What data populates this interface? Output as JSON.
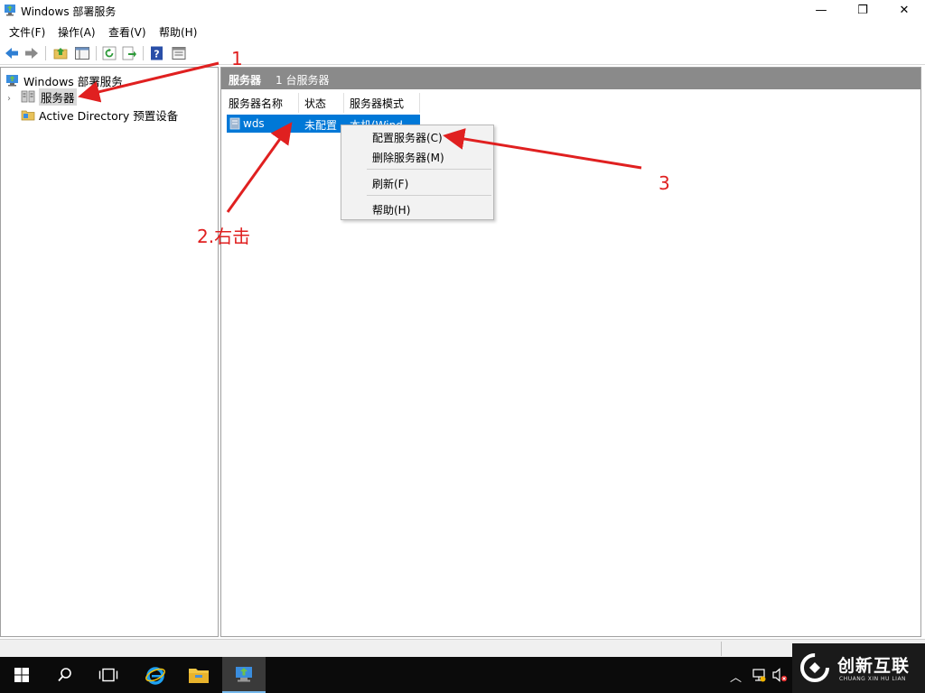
{
  "window": {
    "title": "Windows 部署服务",
    "controls": {
      "minimize": "—",
      "maximize": "❐",
      "close": "✕"
    }
  },
  "menubar": {
    "items": [
      {
        "label": "文件(F)"
      },
      {
        "label": "操作(A)"
      },
      {
        "label": "查看(V)"
      },
      {
        "label": "帮助(H)"
      }
    ]
  },
  "toolbar": {
    "buttons": [
      "back-icon",
      "forward-icon",
      "up-folder-icon",
      "show-hide-tree-icon",
      "refresh-icon",
      "export-icon",
      "help-icon",
      "properties-icon"
    ]
  },
  "tree": {
    "root": {
      "label": "Windows 部署服务",
      "icon": "deployment-services-icon"
    },
    "items": [
      {
        "label": "服务器",
        "icon": "servers-icon",
        "selected": true,
        "expandable": true
      },
      {
        "label": "Active Directory 预置设备",
        "icon": "active-directory-folder-icon",
        "selected": false
      }
    ]
  },
  "right_pane": {
    "header_title": "服务器",
    "header_count": "1 台服务器",
    "columns": [
      {
        "label": "服务器名称"
      },
      {
        "label": "状态"
      },
      {
        "label": "服务器模式"
      }
    ],
    "rows": [
      {
        "name": "wds",
        "status": "未配置",
        "mode": "本机(Wind"
      }
    ]
  },
  "context_menu": {
    "items": [
      {
        "label": "配置服务器(C)"
      },
      {
        "label": "删除服务器(M)"
      },
      {
        "label": "刷新(F)"
      },
      {
        "label": "帮助(H)"
      }
    ]
  },
  "annotations": {
    "step1": "1",
    "step2": "2.右击",
    "step3": "3",
    "color": "#e02020"
  },
  "taskbar": {
    "buttons": [
      "start-icon",
      "search-icon",
      "task-view-icon",
      "internet-explorer-icon",
      "file-explorer-icon",
      "wds-app-icon"
    ],
    "tray": [
      "show-hidden-icons-icon",
      "network-icon",
      "volume-icon"
    ]
  },
  "watermark": {
    "text": "创新互联",
    "sub": "CHUANG XIN HU LIAN"
  },
  "colors": {
    "selection": "#0078d7",
    "header_bar": "#8a8a8a",
    "taskbar": "#0b0b0b"
  }
}
